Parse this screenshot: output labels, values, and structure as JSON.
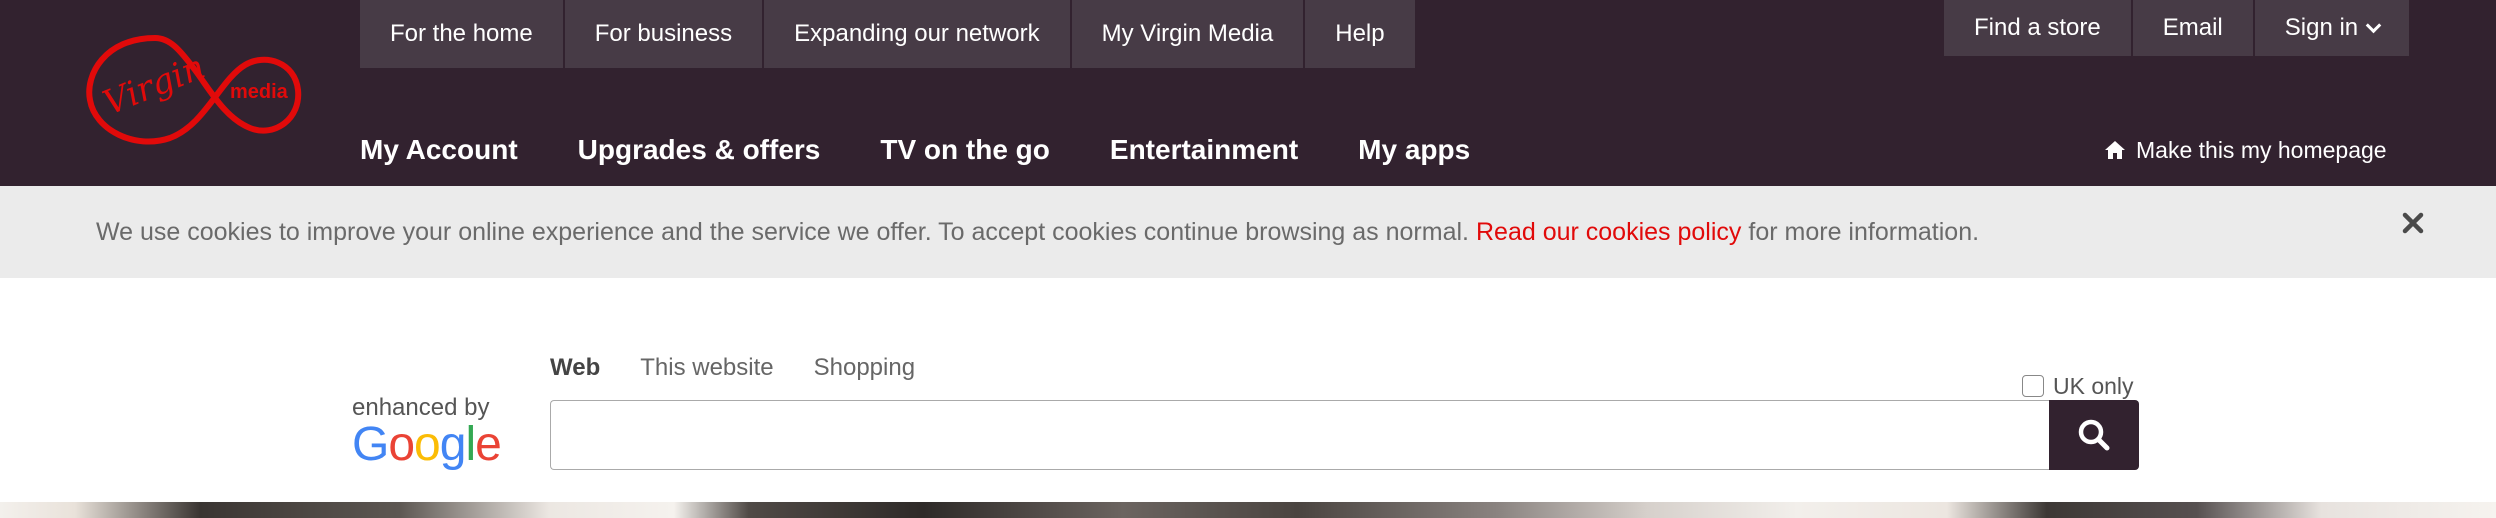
{
  "brand": {
    "logo_word_1": "Virgin",
    "logo_word_2": "media",
    "logo_color": "#e10a0a"
  },
  "colors": {
    "header_bg": "#32222f",
    "nav_item_bg": "#473b46",
    "cookie_bg": "#ebebeb",
    "link_red": "#e10a0a"
  },
  "top_nav": {
    "items": [
      "For the home",
      "For business",
      "Expanding our network",
      "My Virgin Media",
      "Help"
    ]
  },
  "right_nav": {
    "find_store": "Find a store",
    "email": "Email",
    "sign_in": "Sign in"
  },
  "main_nav": {
    "items": [
      "My Account",
      "Upgrades & offers",
      "TV on the go",
      "Entertainment",
      "My apps"
    ]
  },
  "homepage_link": {
    "label": "Make this my homepage",
    "icon": "home-icon"
  },
  "cookie_banner": {
    "text_before": "We use cookies to improve your online experience and the service we offer. To accept cookies continue browsing as normal.",
    "link_text": "Read our cookies policy",
    "text_after": "for more information.",
    "close_icon": "close-icon"
  },
  "search": {
    "enhanced_by": "enhanced by",
    "google_letters": [
      "G",
      "o",
      "o",
      "g",
      "l",
      "e"
    ],
    "google_colors": [
      "#4285f4",
      "#ea4335",
      "#fbbc05",
      "#4285f4",
      "#34a853",
      "#ea4335"
    ],
    "tabs": [
      "Web",
      "This website",
      "Shopping"
    ],
    "active_tab": "Web",
    "uk_only_label": "UK only",
    "uk_only_checked": false,
    "query_value": "",
    "button_icon": "search-icon"
  }
}
